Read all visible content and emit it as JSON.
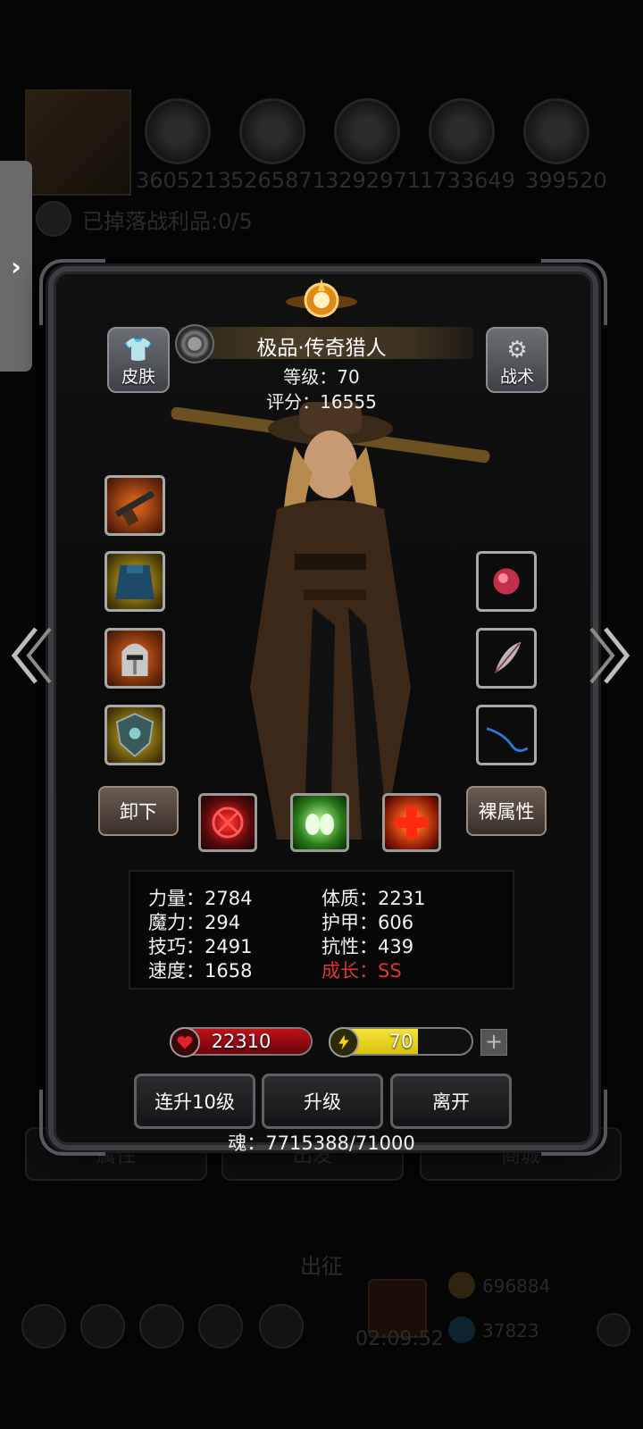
{
  "background": {
    "resources": [
      "3605213",
      "5265871",
      "3292971",
      "1733649",
      "399520"
    ],
    "loot_text": "已掉落战利品:0/5",
    "tabs": [
      "属性",
      "出发",
      "商城"
    ],
    "expedition_label": "出征",
    "timer": "02:09:52",
    "gold": "696884",
    "gems": "37823"
  },
  "drawer": {
    "icon": "›"
  },
  "header": {
    "name": "极品·传奇猎人",
    "level": "等级：70",
    "score": "评分：16555"
  },
  "buttons": {
    "skin": "皮肤",
    "tactics": "战术",
    "unequip": "卸下",
    "base_stats": "裸属性",
    "upgrade_10": "连升10级",
    "upgrade": "升级",
    "leave": "离开"
  },
  "equipment_left": [
    "rifle-icon",
    "cloak-icon",
    "helmet-icon",
    "shield-icon"
  ],
  "equipment_right": [
    "ruby-gem-icon",
    "feather-icon",
    "whip-icon"
  ],
  "skills": [
    "target-skill-icon",
    "poison-skill-icon",
    "heal-skill-icon"
  ],
  "stats": {
    "strength": "力量：2784",
    "magic": "魔力：294",
    "skill": "技巧：2491",
    "speed": "速度：1658",
    "constitution": "体质：2231",
    "armor": "护甲：606",
    "resistance": "抗性：439",
    "growth": "成长：SS"
  },
  "bars": {
    "hp": "22310",
    "energy": "70",
    "energy_fill_ratio": 0.62
  },
  "soul": "魂：7715388/71000",
  "colors": {
    "hp": "#c0101a",
    "energy": "#d9c20c",
    "growth": "#e0352a"
  }
}
